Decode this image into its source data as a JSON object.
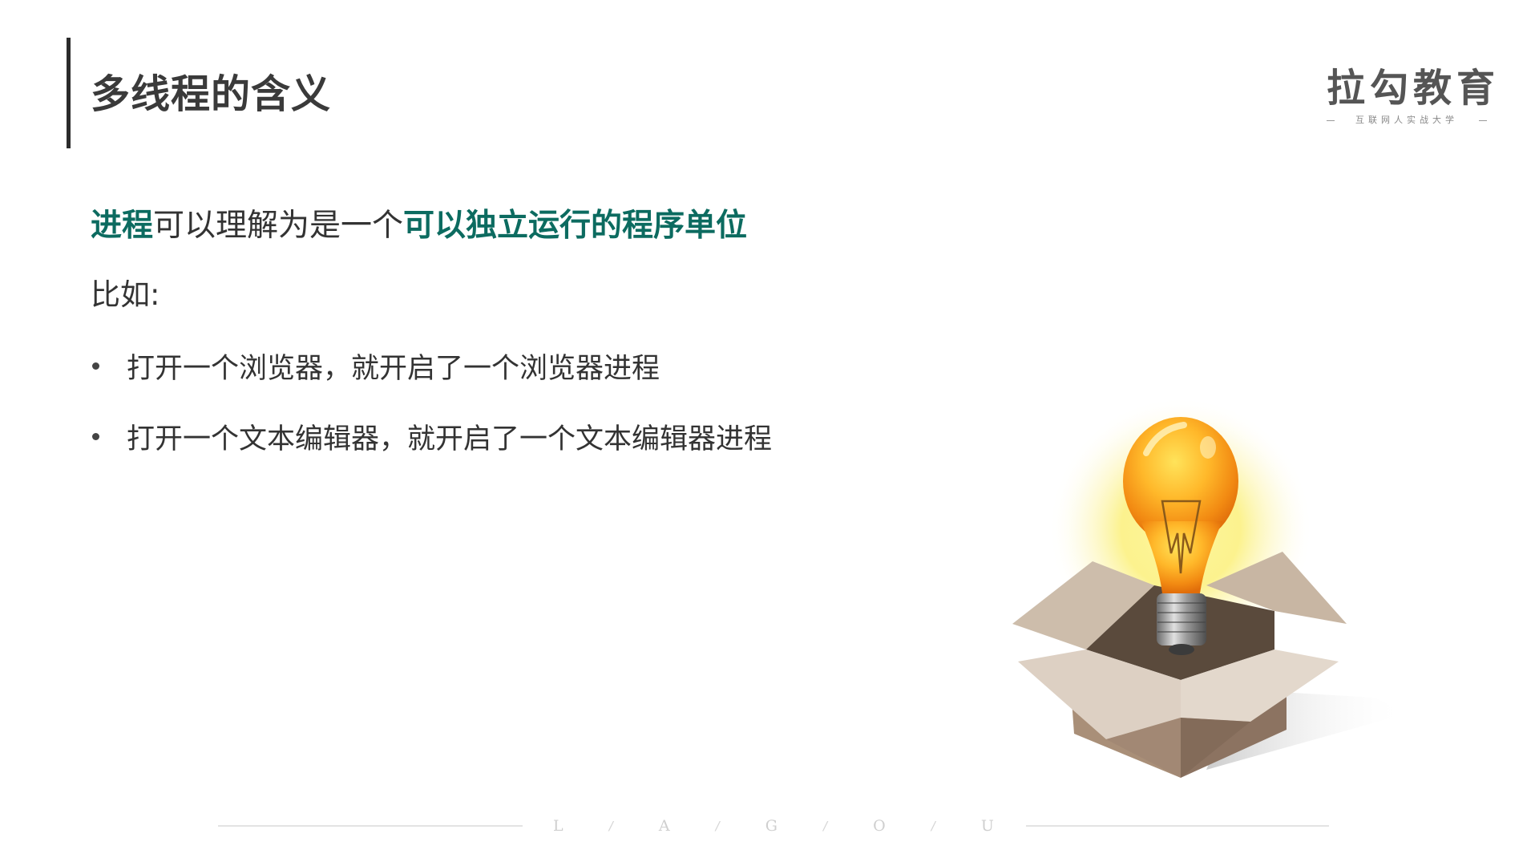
{
  "slide": {
    "title": "多线程的含义"
  },
  "logo": {
    "main": "拉勾教育",
    "sub": "互联网人实战大学"
  },
  "content": {
    "definition": {
      "part1_highlight": "进程",
      "part2": "可以理解为是一个",
      "part3_highlight": "可以独立运行的程序单位"
    },
    "example_label": "比如:",
    "bullets": [
      "打开一个浏览器，就开启了一个浏览器进程",
      "打开一个文本编辑器，就开启了一个文本编辑器进程"
    ]
  },
  "illustration": {
    "icon": "lightbulb-in-box-icon"
  },
  "footer": {
    "letters": [
      "L",
      "/",
      "A",
      "/",
      "G",
      "/",
      "O",
      "/",
      "U"
    ]
  },
  "colors": {
    "accent": "#0c6b60",
    "text": "#333333",
    "title": "#3a3a3a",
    "logo": "#555555",
    "footer": "#cfcfcf"
  }
}
